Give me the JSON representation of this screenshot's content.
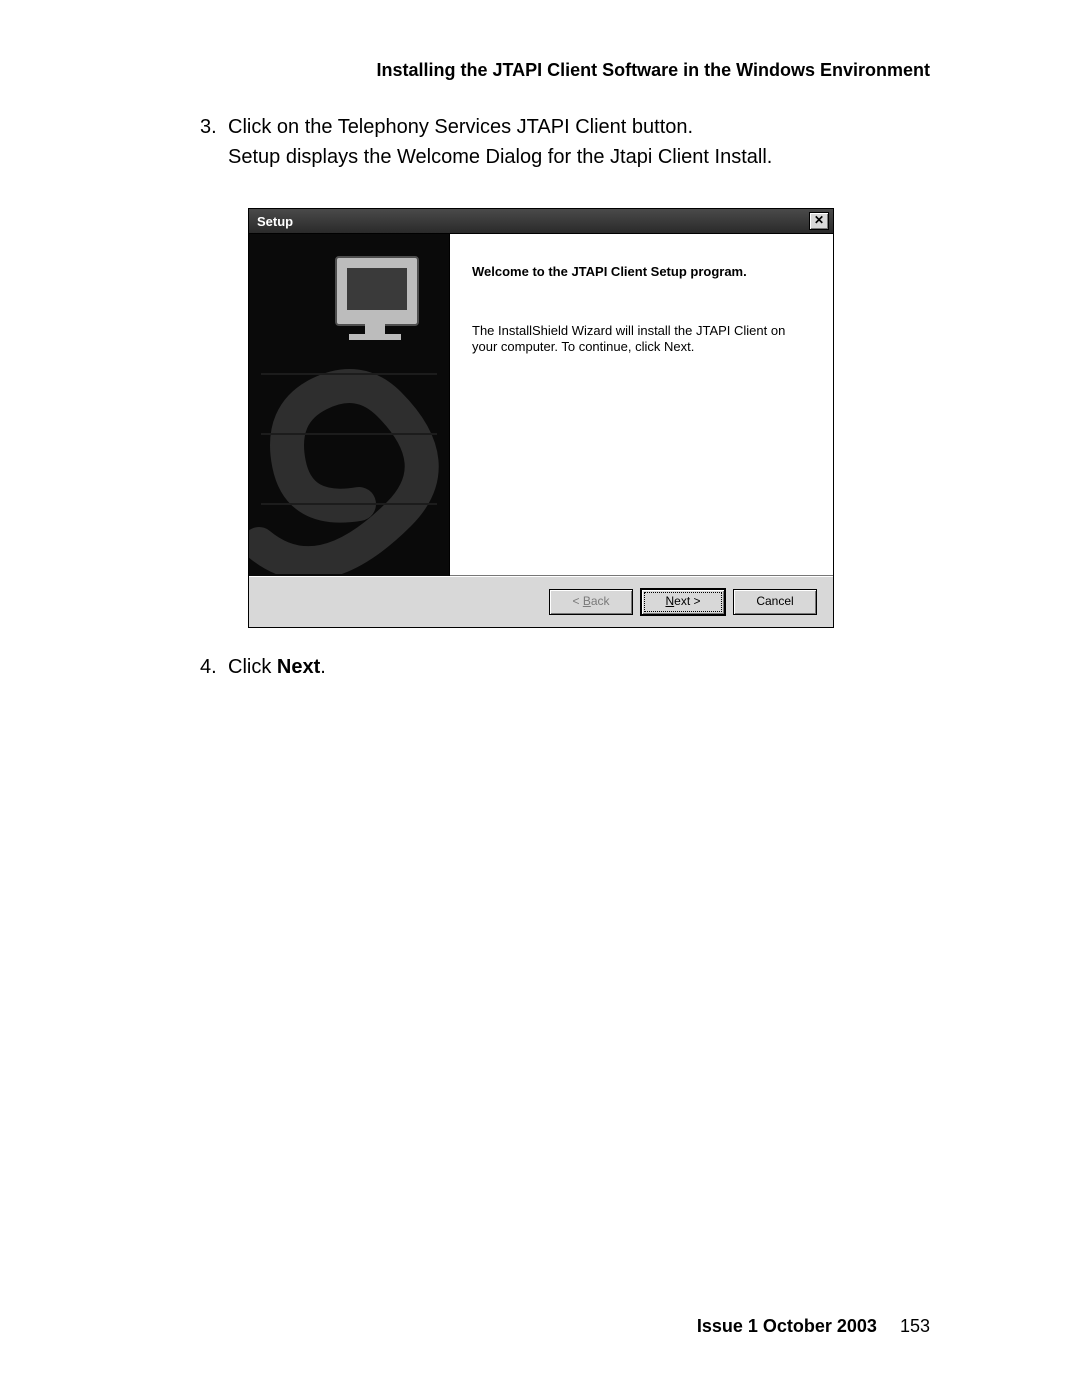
{
  "header": {
    "running_title": "Installing the JTAPI Client Software in the Windows Environment"
  },
  "steps": {
    "s3": {
      "number": "3.",
      "line1": "Click on the Telephony Services JTAPI Client button.",
      "line2": "Setup displays the Welcome Dialog for the Jtapi Client Install."
    },
    "s4": {
      "number": "4.",
      "prefix": "Click ",
      "bold": "Next",
      "suffix": "."
    }
  },
  "window": {
    "title": "Setup",
    "close_label": "✕",
    "welcome_heading": "Welcome to the JTAPI Client Setup program.",
    "description": "The InstallShield Wizard will install the JTAPI Client on your computer. To continue, click Next.",
    "buttons": {
      "back_prefix": "< ",
      "back_ul": "B",
      "back_rest": "ack",
      "next_ul": "N",
      "next_rest": "ext >",
      "cancel": "Cancel"
    }
  },
  "footer": {
    "issue": "Issue 1   October 2003",
    "page": "153"
  }
}
